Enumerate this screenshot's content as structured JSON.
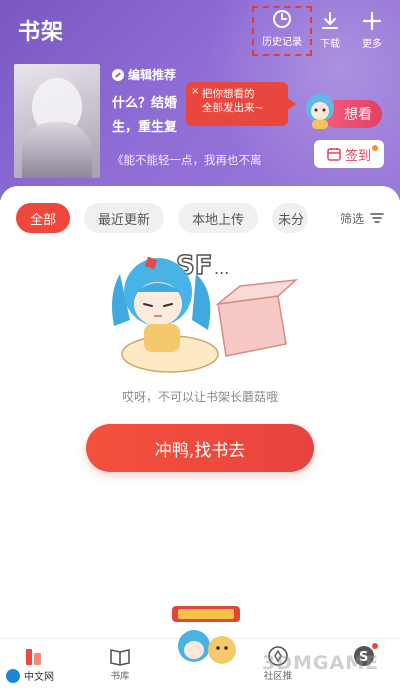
{
  "header": {
    "title": "书架",
    "toolbar": {
      "history_label": "历史记录",
      "download_label": "下载",
      "more_label": "更多"
    },
    "recommend": {
      "tag": "编辑推荐",
      "line1": "什么？结婚",
      "line2": "生，重生复",
      "quote": "《能不能轻一点，我再也不离",
      "tooltip_line1": "把你想看的",
      "tooltip_line2": "全部发出来~",
      "tooltip_close": "×",
      "want_label": "想看",
      "checkin_label": "签到"
    }
  },
  "filters": [
    {
      "label": "全部",
      "active": true
    },
    {
      "label": "最近更新",
      "active": false
    },
    {
      "label": "本地上传",
      "active": false
    },
    {
      "label": "未分",
      "active": false
    }
  ],
  "filter_button": {
    "label": "筛选",
    "icon": "filter-icon"
  },
  "empty": {
    "message": "哎呀，不可以让书架长蘑菇哦",
    "cta_label": "冲鸭,找书去"
  },
  "bottom_nav": {
    "store_label": "书库",
    "discover_label": "社区推"
  },
  "colors": {
    "header_purple": "#8f6dd6",
    "accent_red": "#f0473d",
    "want_pink": "#e54066"
  },
  "watermarks": {
    "left": "中文网",
    "right": "3DMGAME"
  }
}
